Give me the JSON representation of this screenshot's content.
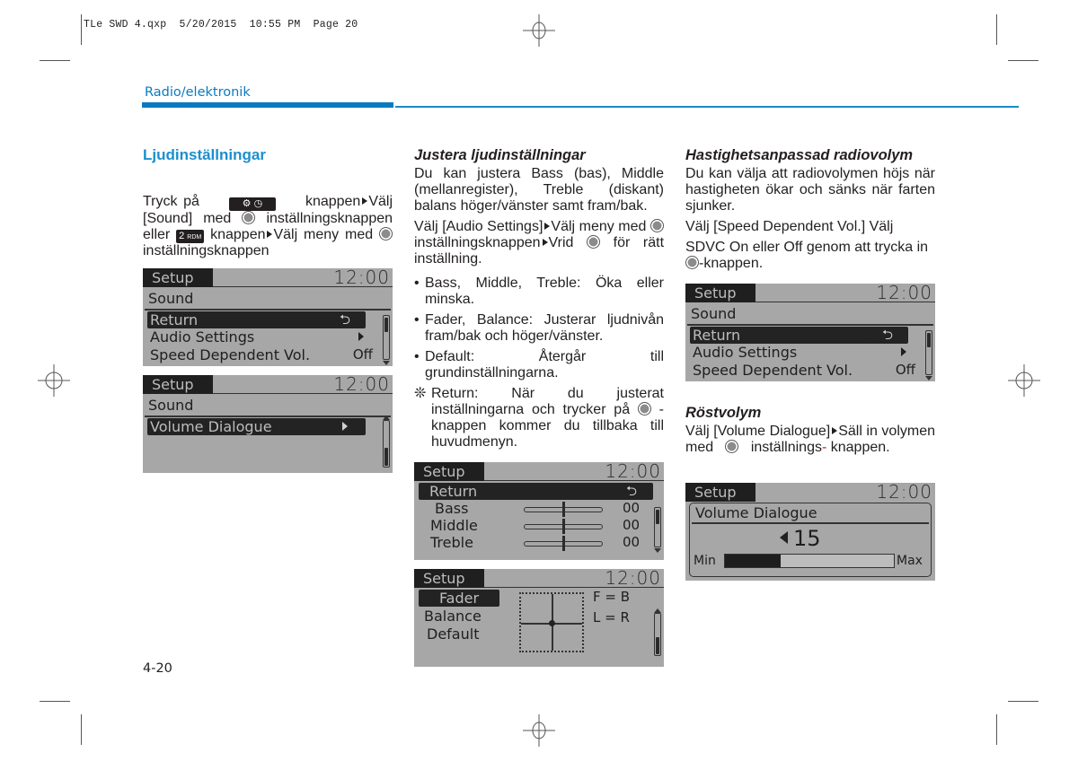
{
  "slug": "TLe SWD 4.qxp  5/20/2015  10:55 PM  Page 20",
  "header": {
    "section": "Radio/elektronik"
  },
  "page_number": "4-20",
  "colors": {
    "accent": "#0a7ac0",
    "heading": "#1b8fcf",
    "lcd_bg": "#a7a7a7",
    "hyphen": "#d0161b"
  },
  "col1": {
    "heading": "Ljudinställningar",
    "intro": {
      "t1": "Tryck på",
      "t2": "knappen",
      "t3": "Välj [Sound] med",
      "t4": "inställningsknappen eller",
      "key_2rdm": "2",
      "key_2rdm_small": "RDM",
      "t5": "knappen",
      "t6": "Välj meny med",
      "t7": "inställningsknappen"
    },
    "screen1": {
      "title": "Setup",
      "clock": "12:00",
      "subtitle": "Sound",
      "rows": [
        {
          "label": "Return",
          "value_icon": "return-arrow"
        },
        {
          "label": "Audio Settings",
          "value_icon": "arrow-right"
        },
        {
          "label": "Speed Dependent Vol.",
          "value": "Off"
        }
      ],
      "return_glyph": "⮌"
    },
    "screen2": {
      "title": "Setup",
      "clock": "12:00",
      "subtitle": "Sound",
      "rows": [
        {
          "label": "Volume Dialogue",
          "value_icon": "arrow-right"
        }
      ]
    }
  },
  "col2": {
    "heading": "Justera ljudinställningar",
    "p1": "Du kan justera Bass (bas), Middle (mellanregister), Treble (diskant) balans höger/vänster samt fram/bak.",
    "p2": {
      "a": "Välj [Audio Settings]",
      "b": "Välj meny med",
      "c": "inställningsknappen",
      "d": "Vrid",
      "e": "för rätt inställning."
    },
    "bullets": [
      "Bass, Middle, Treble: Öka eller minska.",
      "Fader, Balance: Justerar ljudnivån fram/bak och höger/vänster.",
      "Default: Återgår till grundinställningarna."
    ],
    "note": {
      "mark": "❊",
      "a": "Return: När du justerat inställningarna och trycker på",
      "b": "-knappen kommer du tillbaka till huvudmenyn."
    },
    "screen3": {
      "title": "Setup",
      "clock": "12:00",
      "return_label": "Return",
      "return_glyph": "⮌",
      "eq": [
        {
          "label": "Bass",
          "value": "00",
          "level": 0.5
        },
        {
          "label": "Middle",
          "value": "00",
          "level": 0.5
        },
        {
          "label": "Treble",
          "value": "00",
          "level": 0.5
        }
      ]
    },
    "screen4": {
      "title": "Setup",
      "clock": "12:00",
      "menu": [
        "Fader",
        "Balance",
        "Default"
      ],
      "selected": "Fader",
      "fb_label": "F = B",
      "lr_label": "L = R"
    }
  },
  "col3": {
    "heading1": "Hastighetsanpassad radiovolym",
    "p1": "Du kan välja att radiovolymen höjs när hastigheten ökar och sänks när farten sjunker.",
    "p2": "Välj [Speed Dependent Vol.] Välj",
    "p3a": "SDVC On eller Off  genom att trycka in",
    "p3b": "-knappen.",
    "screen5": {
      "title": "Setup",
      "clock": "12:00",
      "subtitle": "Sound",
      "rows": [
        {
          "label": "Return",
          "value_icon": "return-arrow"
        },
        {
          "label": "Audio Settings",
          "value_icon": "arrow-right"
        },
        {
          "label": "Speed Dependent Vol.",
          "value": "Off"
        }
      ],
      "return_glyph": "⮌"
    },
    "heading2": "Röstvolym",
    "p4": {
      "a": "Välj [Volume Dialogue]",
      "b": "Säll in volymen med",
      "c": "inställnings",
      "d": "knappen."
    },
    "screen6": {
      "title": "Setup",
      "clock": "12:00",
      "panel_title": "Volume Dialogue",
      "volume": "15",
      "volume_fraction": 0.33,
      "min_label": "Min",
      "max_label": "Max"
    }
  }
}
